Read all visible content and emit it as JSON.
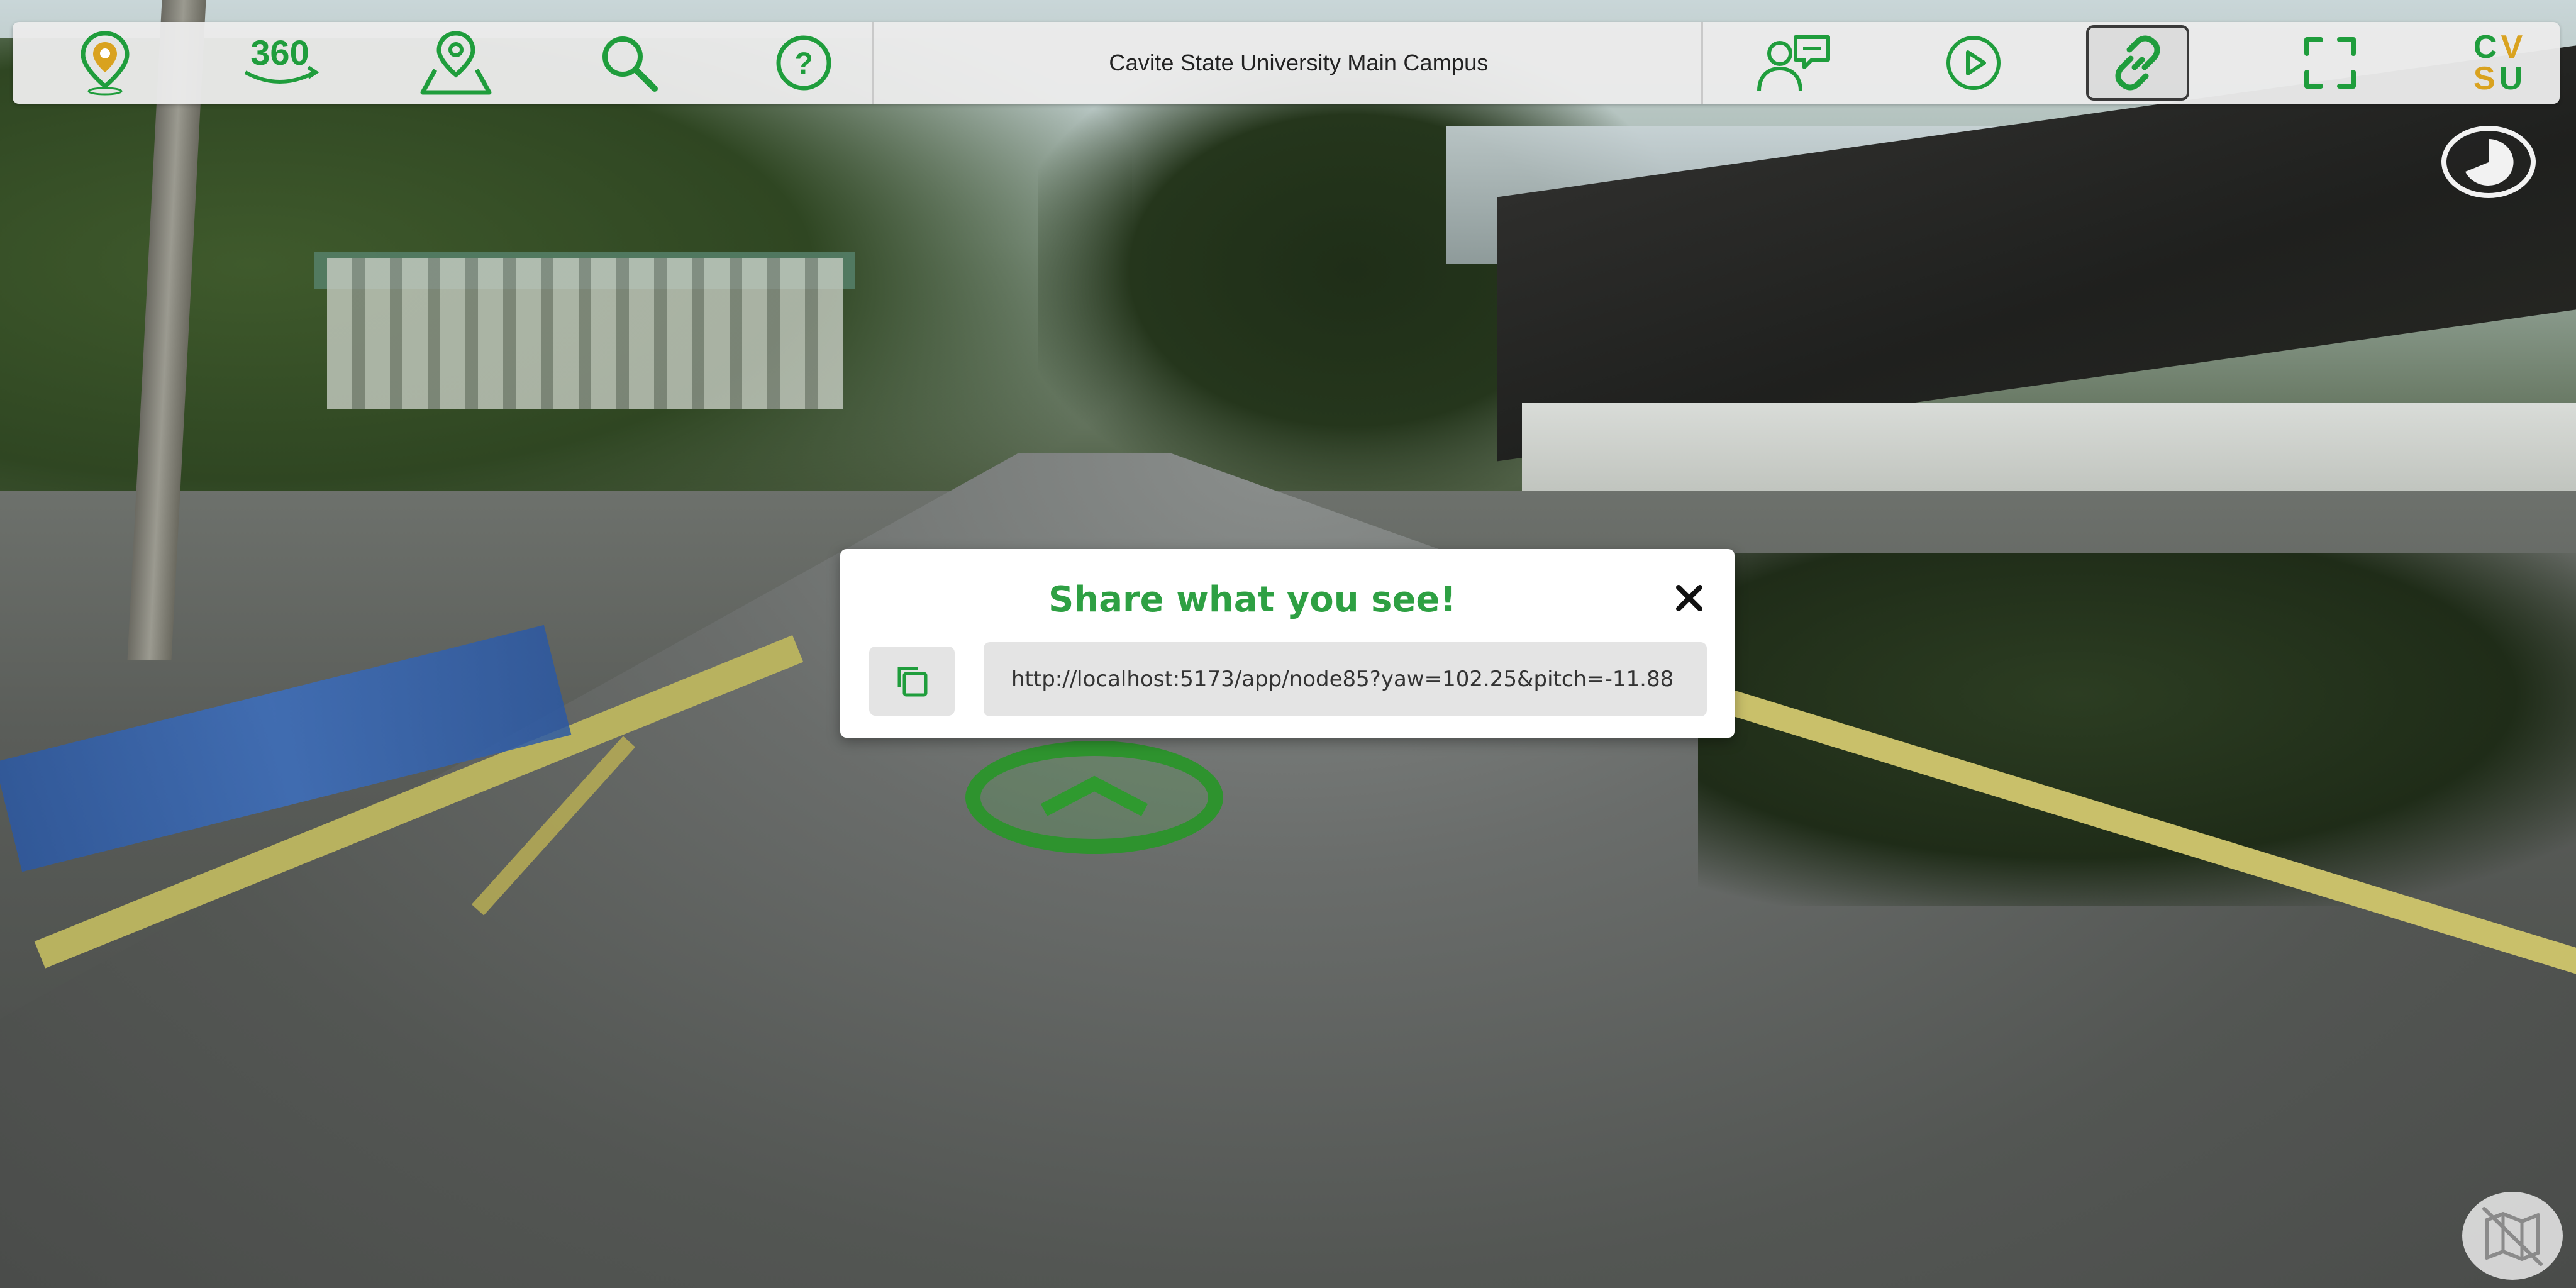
{
  "toolbar": {
    "title": "Cavite State University Main Campus",
    "buttons": [
      {
        "name": "location-pin-icon"
      },
      {
        "name": "360-view-icon",
        "text": "360"
      },
      {
        "name": "map-marker-icon"
      },
      {
        "name": "search-icon"
      },
      {
        "name": "help-icon"
      },
      {
        "name": "feedback-icon"
      },
      {
        "name": "play-tour-icon"
      },
      {
        "name": "share-link-icon",
        "active": true
      },
      {
        "name": "fullscreen-icon"
      }
    ],
    "logo": {
      "line1": "CV",
      "line2": "SU"
    },
    "colors": {
      "accent_green": "#1f9d3c",
      "accent_yellow": "#d9a21f",
      "bar": "#ebebeb"
    }
  },
  "share_modal": {
    "title": "Share what you see!",
    "url": "http://localhost:5173/app/node85?yaw=102.25&pitch=-11.88",
    "title_color": "#2ea043"
  }
}
